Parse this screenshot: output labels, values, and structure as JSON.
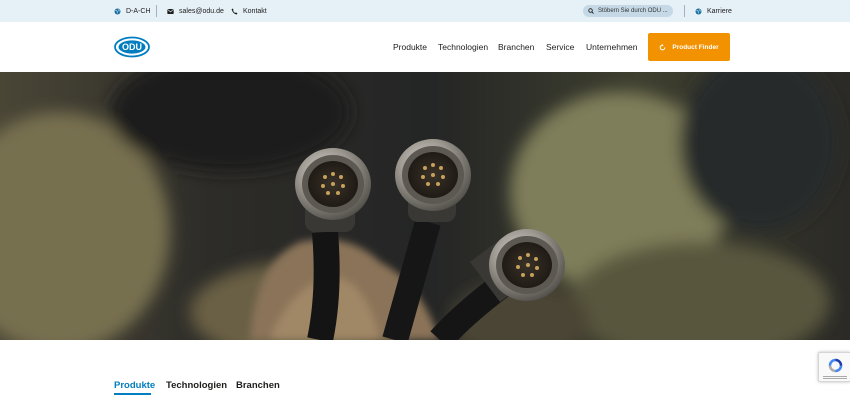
{
  "topbar": {
    "region": "D-A-CH",
    "email": "sales@odu.de",
    "contact": "Kontakt",
    "search_placeholder": "Stöbern Sie durch ODU ...",
    "career": "Karriere"
  },
  "header": {
    "logo_text": "ODU",
    "nav": [
      "Produkte",
      "Technologien",
      "Branchen",
      "Service",
      "Unternehmen"
    ],
    "cta_label": "Product Finder"
  },
  "tabs": {
    "items": [
      "Produkte",
      "Technologien",
      "Branchen"
    ],
    "active_index": 0
  },
  "colors": {
    "accent_blue": "#007ec0",
    "cta_orange": "#f39200",
    "topbar_bg": "#e6f0f7"
  },
  "icons": {
    "region": "globe-icon",
    "email": "envelope-icon",
    "contact": "phone-icon",
    "search": "search-icon",
    "career": "globe-icon",
    "cta": "refresh-icon",
    "recaptcha": "recaptcha-icon"
  }
}
